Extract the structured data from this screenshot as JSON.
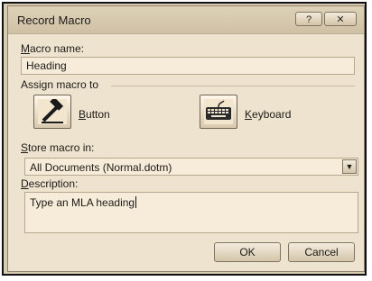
{
  "window": {
    "title": "Record Macro",
    "help_glyph": "?",
    "close_glyph": "✕"
  },
  "macro_name": {
    "label": "Macro name:",
    "value": "Heading"
  },
  "assign": {
    "label": "Assign macro to",
    "button_label": "Button",
    "keyboard_label": "Keyboard",
    "button_icon": "hammer-icon",
    "keyboard_icon": "keyboard-icon"
  },
  "store": {
    "label": "Store macro in:",
    "selected": "All Documents (Normal.dotm)",
    "dropdown_glyph": "▼"
  },
  "description": {
    "label": "Description:",
    "value": "Type an MLA heading"
  },
  "actions": {
    "ok": "OK",
    "cancel": "Cancel"
  }
}
